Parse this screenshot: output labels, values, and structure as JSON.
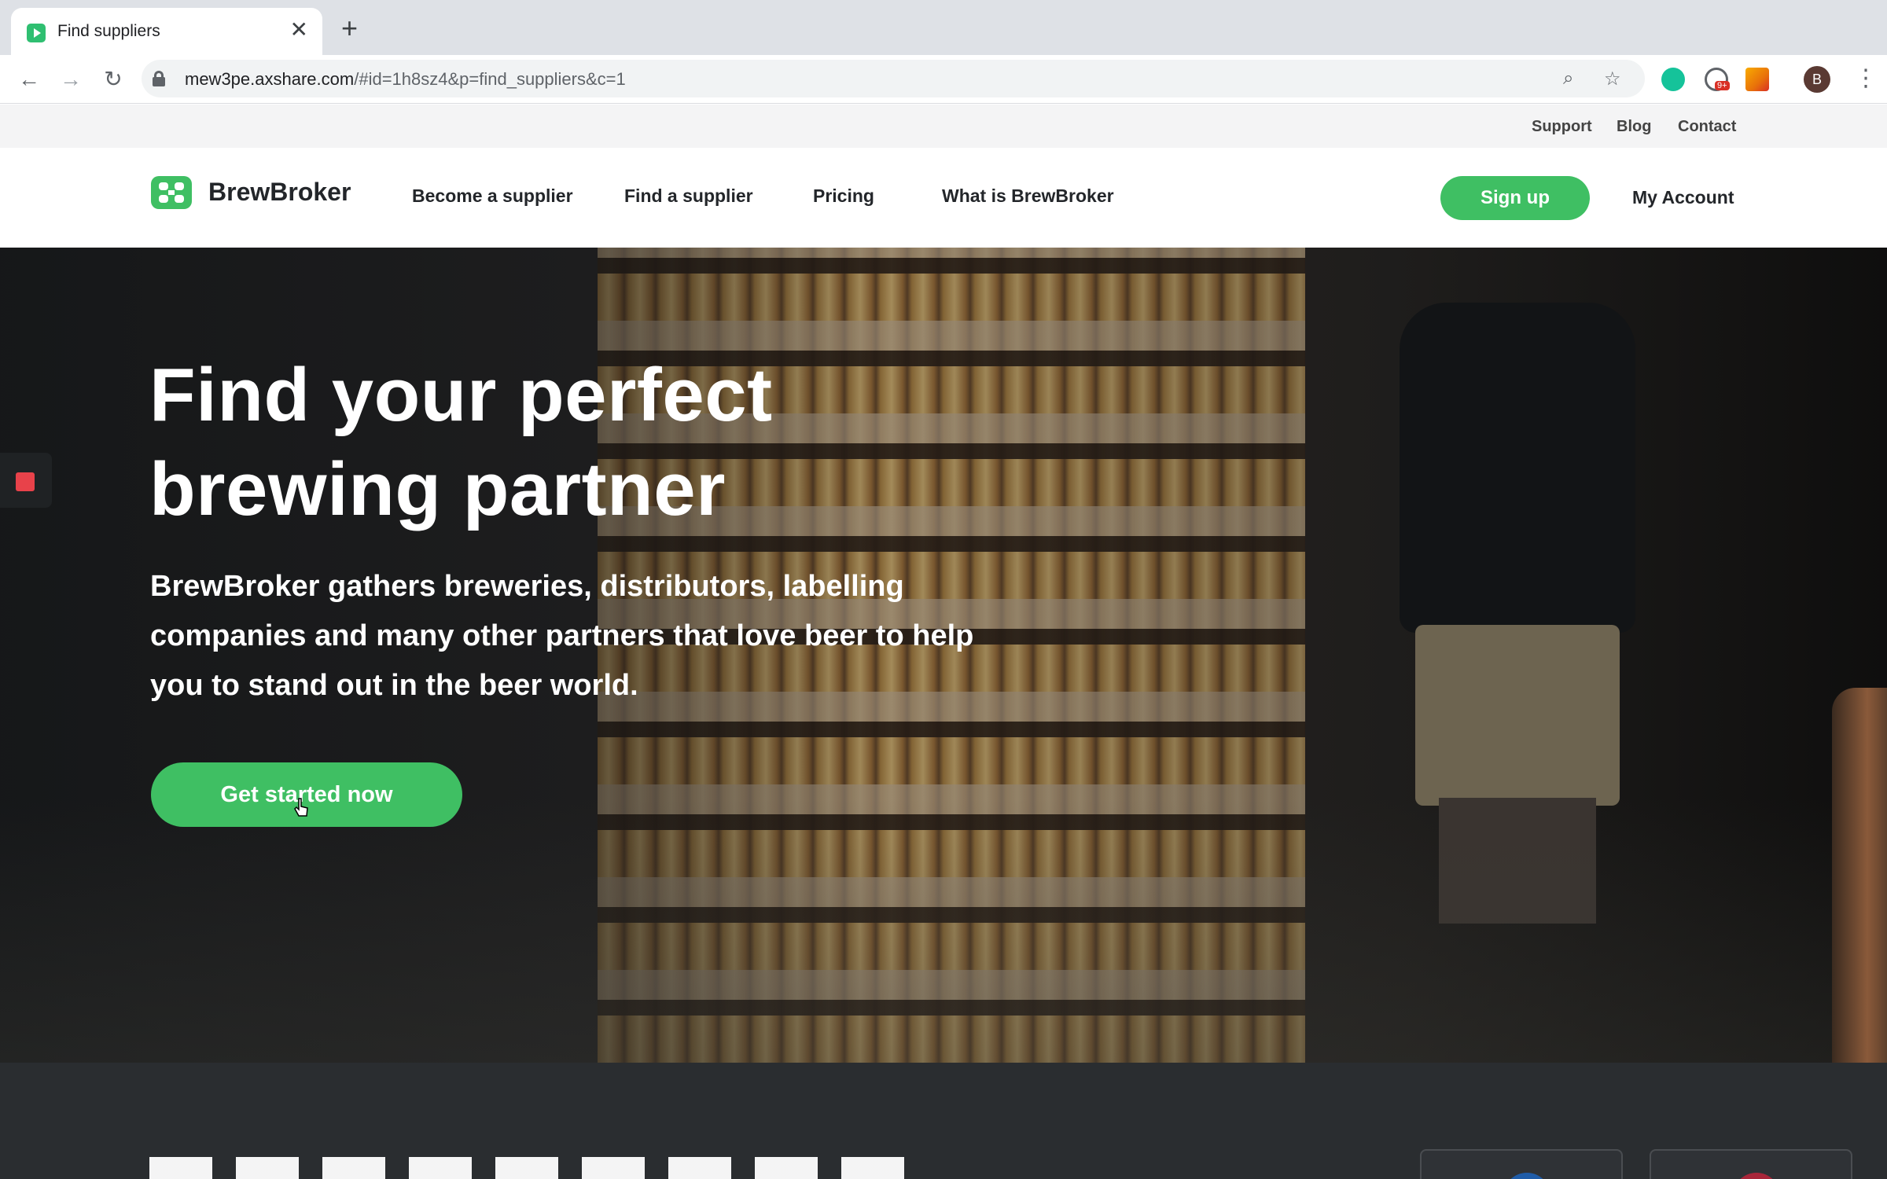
{
  "browser": {
    "tab_title": "Find suppliers",
    "url_host": "mew3pe.axshare.com",
    "url_path": "/#id=1h8sz4&p=find_suppliers&c=1",
    "profile_initial": "B",
    "notification_badge": "9+"
  },
  "utility_nav": {
    "items": [
      "Support",
      "Blog",
      "Contact"
    ]
  },
  "header": {
    "logo_text": "BrewBroker",
    "nav": [
      "Become a supplier",
      "Find a supplier",
      "Pricing",
      "What is BrewBroker"
    ],
    "signup_label": "Sign up",
    "account_label": "My Account"
  },
  "hero": {
    "title_line1": "Find your perfect",
    "title_line2": "brewing partner",
    "subtitle": "BrewBroker gathers breweries, distributors, labelling companies and many other partners that love beer to help you to stand out in the beer world.",
    "cta_label": "Get started now"
  },
  "colors": {
    "brand_green": "#3fbf63",
    "dark_section": "#2a2d30",
    "record_indicator": "#e8424a"
  },
  "icons": [
    "back-icon",
    "forward-icon",
    "reload-icon",
    "lock-icon",
    "zoom-icon",
    "star-icon",
    "grammarly-icon",
    "extension-icon",
    "analytics-icon",
    "menu-icon",
    "cursor-icon",
    "record-icon"
  ]
}
